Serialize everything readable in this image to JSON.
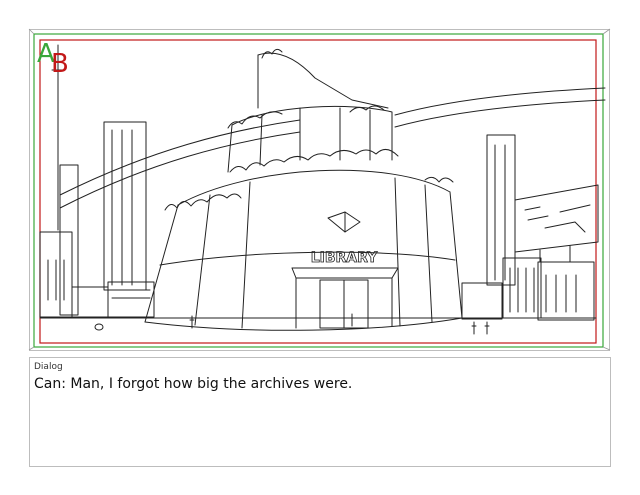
{
  "panel": {
    "layer_a_label": "A",
    "layer_b_label": "B",
    "layer_a_color": "#3aa63a",
    "layer_b_color": "#c21818",
    "safe_frame_color": "#c21818",
    "outer_frame_color": "#3aa63a",
    "sign_text": "LIBRARY"
  },
  "dialog": {
    "label": "Dialog",
    "text": "Can: Man, I forgot how big the archives were."
  }
}
